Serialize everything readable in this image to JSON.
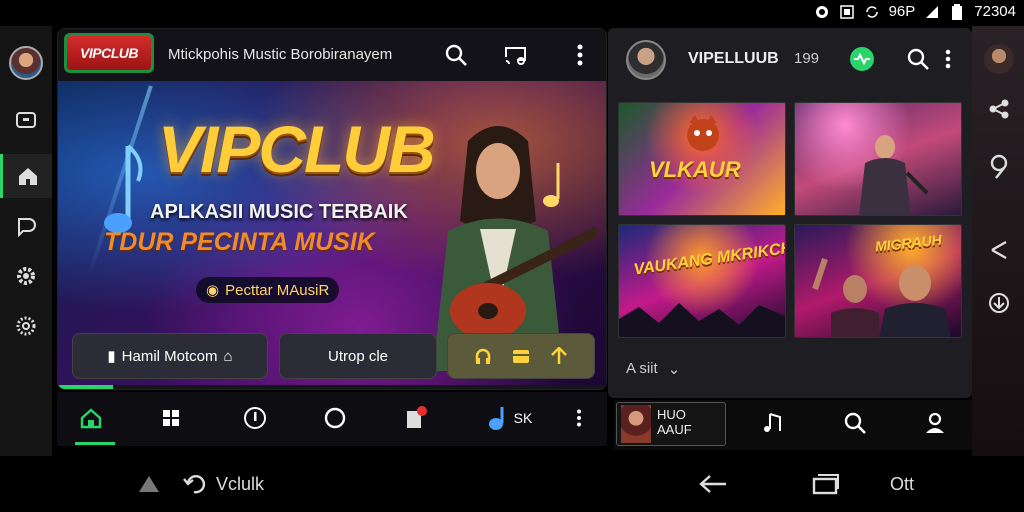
{
  "status_bar": {
    "signal_text": "96P",
    "time": "72304"
  },
  "header": {
    "logo": "VIPCLUB",
    "title": "Mtickpohis Mustic Borobiranayem"
  },
  "banner": {
    "title": "VIPCLUB",
    "subtitle_1": "APLKASII MUSIC TERBAIK",
    "subtitle_2": "TDUR PECINTA MUSIK",
    "pill": "Pecttar MAusiR",
    "buttons": [
      {
        "label": "Hamil Motcom"
      },
      {
        "label": "Utrop cle"
      }
    ],
    "progress": 0.1
  },
  "bottom_nav": {
    "extra_label": "SK"
  },
  "right_panel": {
    "title": "VIPELLUUB",
    "count": "199",
    "tiles": [
      {
        "text": "VLKAUR"
      },
      {
        "text": ""
      },
      {
        "text": "VAUKANG MKRIKCHUS"
      },
      {
        "text": "MIGRAUH"
      }
    ],
    "footer": "A siit"
  },
  "mini_player": {
    "title": "HUO AAUF"
  },
  "system_nav": {
    "left_label": "Vclulk",
    "right_label": "Ott"
  },
  "colors": {
    "accent": "#2bd46a",
    "brand_red": "#d62c2c",
    "gold": "#ffcc3a"
  }
}
